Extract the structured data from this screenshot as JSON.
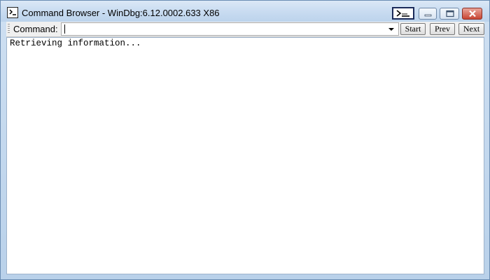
{
  "window": {
    "title": "Command Browser - WinDbg:6.12.0002.633 X86",
    "icons": {
      "app": "command-window-icon",
      "command": "command-window-icon",
      "minimize": "minimize-icon",
      "maximize": "maximize-icon",
      "close": "close-icon"
    }
  },
  "toolbar": {
    "command_label": "Command:",
    "command_value": "",
    "dropdown_icon": "chevron-down-icon",
    "start_label": "Start",
    "prev_label": "Prev",
    "next_label": "Next"
  },
  "output": {
    "text": "Retrieving information..."
  },
  "colors": {
    "titlebar": "#c9dcf1",
    "frame": "#b9d1ea",
    "close_button": "#c84533",
    "content_bg": "#ffffff"
  }
}
